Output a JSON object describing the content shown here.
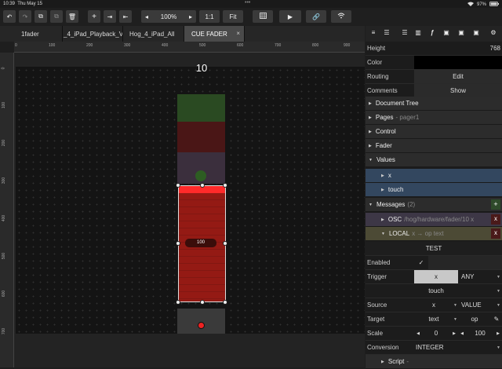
{
  "status": {
    "time": "10:39",
    "date": "Thu May 15",
    "battery": "97%"
  },
  "toolbar": {
    "zoom": "100%",
    "ratio": "1:1",
    "fit": "Fit",
    "zoom_out": "◂",
    "zoom_in": "▸"
  },
  "tabs": [
    {
      "label": "1fader"
    },
    {
      "label": "_4_iPad_Playback_V"
    },
    {
      "label": "Hog_4_iPad_All"
    },
    {
      "label": "CUE FADER",
      "close": "×"
    }
  ],
  "ruler": {
    "top": [
      "0",
      "100",
      "200",
      "300",
      "400",
      "500",
      "600",
      "700",
      "800",
      "900"
    ],
    "left": [
      "0",
      "100",
      "200",
      "300",
      "400",
      "500",
      "600",
      "700"
    ]
  },
  "fader": {
    "number": "10",
    "value": "100"
  },
  "panel": {
    "height_label": "Height",
    "height_value": "768",
    "color_label": "Color",
    "routing_label": "Routing",
    "routing_value": "Edit",
    "comments_label": "Comments",
    "comments_value": "Show",
    "sections": {
      "document_tree": "Document Tree",
      "pages": "Pages",
      "pages_sub": "- pager1",
      "control": "Control",
      "fader": "Fader",
      "values": "Values",
      "messages": "Messages",
      "messages_count": "(2)",
      "script": "Script",
      "script_sub": "-"
    },
    "values": [
      "x",
      "touch"
    ],
    "messages": [
      {
        "proto": "OSC",
        "detail": "/hog/hardware/fader/10 x"
      },
      {
        "proto": "LOCAL",
        "detail": "x → op text"
      }
    ],
    "add": "+",
    "remove": "x",
    "test": "TEST",
    "enabled_label": "Enabled",
    "enabled_value": "✓",
    "trigger_label": "Trigger",
    "trigger_value": "x",
    "trigger_mode": "ANY",
    "trigger2": "touch",
    "source_label": "Source",
    "source_value": "x",
    "source_mode": "VALUE",
    "target_label": "Target",
    "target_value": "text",
    "target_op": "op",
    "scale_label": "Scale",
    "scale_from": "0",
    "scale_to": "100",
    "conversion_label": "Conversion",
    "conversion_value": "INTEGER"
  },
  "colors": {
    "accent": "#ff2a2a",
    "fader_red": "#941a14",
    "values_bg": "#33475f",
    "osc_bg": "#3d3746",
    "local_bg": "#4c4a35"
  }
}
